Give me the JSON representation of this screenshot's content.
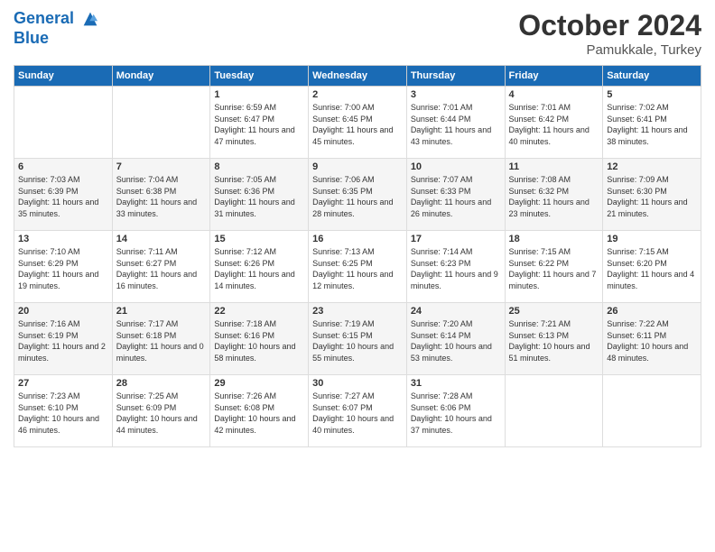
{
  "header": {
    "logo_line1": "General",
    "logo_line2": "Blue",
    "month_title": "October 2024",
    "subtitle": "Pamukkale, Turkey"
  },
  "days_of_week": [
    "Sunday",
    "Monday",
    "Tuesday",
    "Wednesday",
    "Thursday",
    "Friday",
    "Saturday"
  ],
  "weeks": [
    [
      {
        "day": "",
        "info": ""
      },
      {
        "day": "",
        "info": ""
      },
      {
        "day": "1",
        "info": "Sunrise: 6:59 AM\nSunset: 6:47 PM\nDaylight: 11 hours and 47 minutes."
      },
      {
        "day": "2",
        "info": "Sunrise: 7:00 AM\nSunset: 6:45 PM\nDaylight: 11 hours and 45 minutes."
      },
      {
        "day": "3",
        "info": "Sunrise: 7:01 AM\nSunset: 6:44 PM\nDaylight: 11 hours and 43 minutes."
      },
      {
        "day": "4",
        "info": "Sunrise: 7:01 AM\nSunset: 6:42 PM\nDaylight: 11 hours and 40 minutes."
      },
      {
        "day": "5",
        "info": "Sunrise: 7:02 AM\nSunset: 6:41 PM\nDaylight: 11 hours and 38 minutes."
      }
    ],
    [
      {
        "day": "6",
        "info": "Sunrise: 7:03 AM\nSunset: 6:39 PM\nDaylight: 11 hours and 35 minutes."
      },
      {
        "day": "7",
        "info": "Sunrise: 7:04 AM\nSunset: 6:38 PM\nDaylight: 11 hours and 33 minutes."
      },
      {
        "day": "8",
        "info": "Sunrise: 7:05 AM\nSunset: 6:36 PM\nDaylight: 11 hours and 31 minutes."
      },
      {
        "day": "9",
        "info": "Sunrise: 7:06 AM\nSunset: 6:35 PM\nDaylight: 11 hours and 28 minutes."
      },
      {
        "day": "10",
        "info": "Sunrise: 7:07 AM\nSunset: 6:33 PM\nDaylight: 11 hours and 26 minutes."
      },
      {
        "day": "11",
        "info": "Sunrise: 7:08 AM\nSunset: 6:32 PM\nDaylight: 11 hours and 23 minutes."
      },
      {
        "day": "12",
        "info": "Sunrise: 7:09 AM\nSunset: 6:30 PM\nDaylight: 11 hours and 21 minutes."
      }
    ],
    [
      {
        "day": "13",
        "info": "Sunrise: 7:10 AM\nSunset: 6:29 PM\nDaylight: 11 hours and 19 minutes."
      },
      {
        "day": "14",
        "info": "Sunrise: 7:11 AM\nSunset: 6:27 PM\nDaylight: 11 hours and 16 minutes."
      },
      {
        "day": "15",
        "info": "Sunrise: 7:12 AM\nSunset: 6:26 PM\nDaylight: 11 hours and 14 minutes."
      },
      {
        "day": "16",
        "info": "Sunrise: 7:13 AM\nSunset: 6:25 PM\nDaylight: 11 hours and 12 minutes."
      },
      {
        "day": "17",
        "info": "Sunrise: 7:14 AM\nSunset: 6:23 PM\nDaylight: 11 hours and 9 minutes."
      },
      {
        "day": "18",
        "info": "Sunrise: 7:15 AM\nSunset: 6:22 PM\nDaylight: 11 hours and 7 minutes."
      },
      {
        "day": "19",
        "info": "Sunrise: 7:15 AM\nSunset: 6:20 PM\nDaylight: 11 hours and 4 minutes."
      }
    ],
    [
      {
        "day": "20",
        "info": "Sunrise: 7:16 AM\nSunset: 6:19 PM\nDaylight: 11 hours and 2 minutes."
      },
      {
        "day": "21",
        "info": "Sunrise: 7:17 AM\nSunset: 6:18 PM\nDaylight: 11 hours and 0 minutes."
      },
      {
        "day": "22",
        "info": "Sunrise: 7:18 AM\nSunset: 6:16 PM\nDaylight: 10 hours and 58 minutes."
      },
      {
        "day": "23",
        "info": "Sunrise: 7:19 AM\nSunset: 6:15 PM\nDaylight: 10 hours and 55 minutes."
      },
      {
        "day": "24",
        "info": "Sunrise: 7:20 AM\nSunset: 6:14 PM\nDaylight: 10 hours and 53 minutes."
      },
      {
        "day": "25",
        "info": "Sunrise: 7:21 AM\nSunset: 6:13 PM\nDaylight: 10 hours and 51 minutes."
      },
      {
        "day": "26",
        "info": "Sunrise: 7:22 AM\nSunset: 6:11 PM\nDaylight: 10 hours and 48 minutes."
      }
    ],
    [
      {
        "day": "27",
        "info": "Sunrise: 7:23 AM\nSunset: 6:10 PM\nDaylight: 10 hours and 46 minutes."
      },
      {
        "day": "28",
        "info": "Sunrise: 7:25 AM\nSunset: 6:09 PM\nDaylight: 10 hours and 44 minutes."
      },
      {
        "day": "29",
        "info": "Sunrise: 7:26 AM\nSunset: 6:08 PM\nDaylight: 10 hours and 42 minutes."
      },
      {
        "day": "30",
        "info": "Sunrise: 7:27 AM\nSunset: 6:07 PM\nDaylight: 10 hours and 40 minutes."
      },
      {
        "day": "31",
        "info": "Sunrise: 7:28 AM\nSunset: 6:06 PM\nDaylight: 10 hours and 37 minutes."
      },
      {
        "day": "",
        "info": ""
      },
      {
        "day": "",
        "info": ""
      }
    ]
  ]
}
